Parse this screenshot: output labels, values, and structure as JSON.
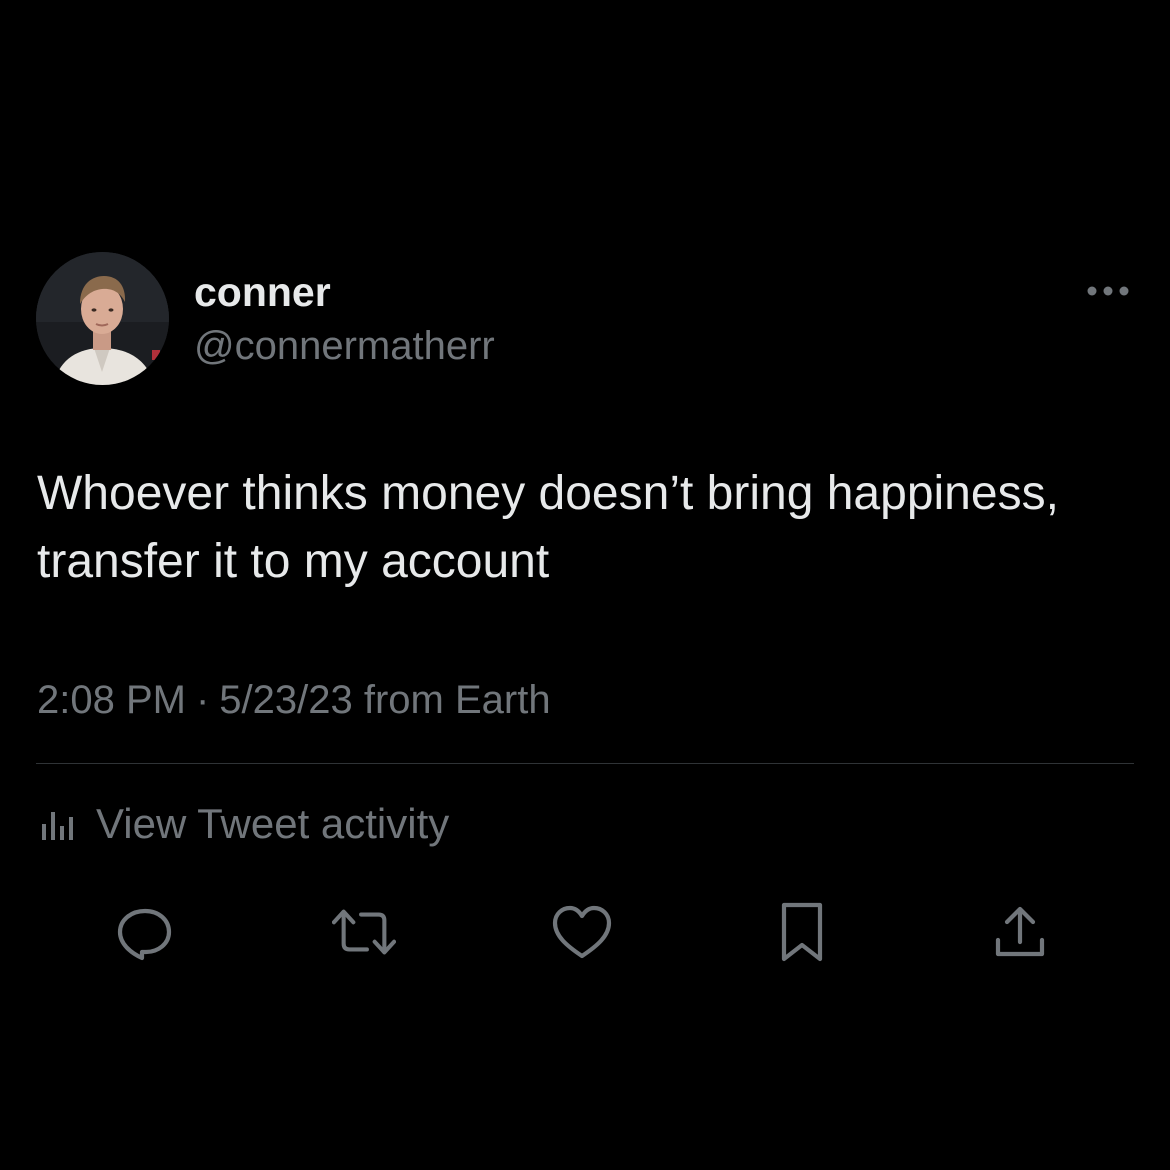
{
  "author": {
    "display_name": "conner",
    "handle": "@connermatherr",
    "avatar_icon": "profile-photo"
  },
  "tweet": {
    "text": "Whoever thinks money doesn’t bring happiness, transfer it to my account",
    "time": "2:08 PM",
    "separator": "·",
    "date_source": "5/23/23 from Earth"
  },
  "activity": {
    "label": "View Tweet activity",
    "icon": "bar-chart-icon"
  },
  "actions": [
    {
      "name": "reply",
      "icon": "speech-bubble-icon"
    },
    {
      "name": "retweet",
      "icon": "retweet-arrows-icon"
    },
    {
      "name": "like",
      "icon": "heart-icon"
    },
    {
      "name": "bookmark",
      "icon": "bookmark-icon"
    },
    {
      "name": "share",
      "icon": "share-upload-icon"
    }
  ],
  "colors": {
    "background": "#000000",
    "primary_text": "#e7e9ea",
    "secondary_text": "#71767b",
    "divider": "#2f3336"
  }
}
